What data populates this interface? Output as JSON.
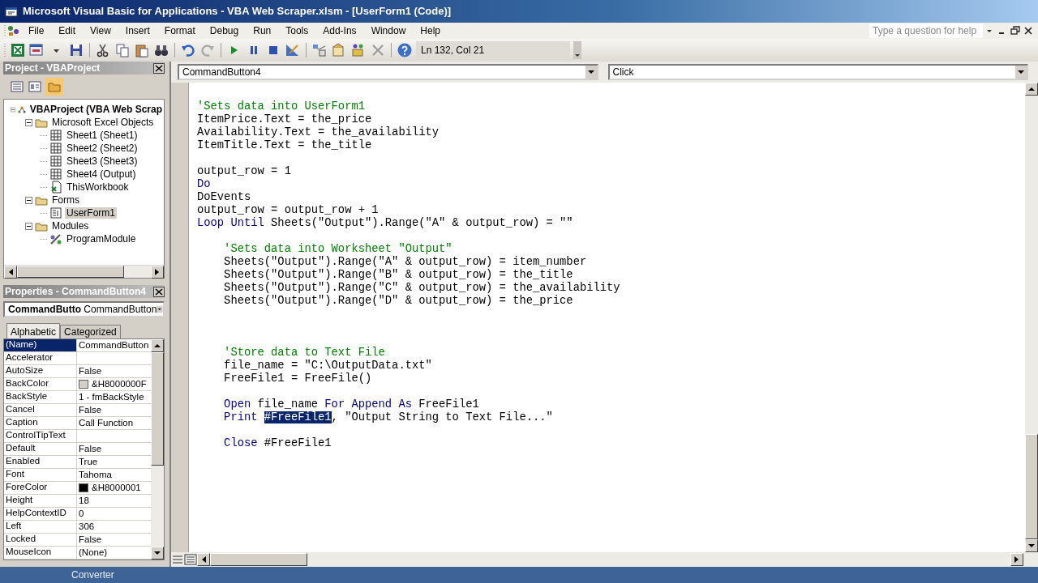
{
  "window": {
    "title": "Microsoft Visual Basic for Applications - VBA Web Scraper.xlsm - [UserForm1 (Code)]"
  },
  "menu": [
    "File",
    "Edit",
    "View",
    "Insert",
    "Format",
    "Debug",
    "Run",
    "Tools",
    "Add-Ins",
    "Window",
    "Help"
  ],
  "help_box": {
    "placeholder": "Type a question for help"
  },
  "toolbar": {
    "position": "Ln 132, Col 21"
  },
  "project": {
    "title": "Project - VBAProject",
    "tree": [
      {
        "label": "VBAProject (VBA Web Scrap",
        "kind": "project",
        "expanded": true,
        "selected": false,
        "children": [
          {
            "label": "Microsoft Excel Objects",
            "kind": "folder",
            "expanded": true,
            "selected": false,
            "children": [
              {
                "label": "Sheet1 (Sheet1)",
                "kind": "sheet",
                "selected": false
              },
              {
                "label": "Sheet2 (Sheet2)",
                "kind": "sheet",
                "selected": false
              },
              {
                "label": "Sheet3 (Sheet3)",
                "kind": "sheet",
                "selected": false
              },
              {
                "label": "Sheet4 (Output)",
                "kind": "sheet",
                "selected": false
              },
              {
                "label": "ThisWorkbook",
                "kind": "workbook",
                "selected": false
              }
            ]
          },
          {
            "label": "Forms",
            "kind": "folder",
            "expanded": true,
            "selected": false,
            "children": [
              {
                "label": "UserForm1",
                "kind": "form",
                "selected": true
              }
            ]
          },
          {
            "label": "Modules",
            "kind": "folder",
            "expanded": true,
            "selected": false,
            "children": [
              {
                "label": "ProgramModule",
                "kind": "module",
                "selected": false
              }
            ]
          }
        ]
      }
    ]
  },
  "properties": {
    "title": "Properties - CommandButton4",
    "object_name": "CommandButto",
    "object_type": "CommandButton",
    "tabs": [
      {
        "label": "Alphabetic",
        "selected": true
      },
      {
        "label": "Categorized",
        "selected": false
      }
    ],
    "rows": [
      {
        "name": "(Name)",
        "value": "CommandButton",
        "selected": true
      },
      {
        "name": "Accelerator",
        "selected": false
      },
      {
        "name": "AutoSize",
        "value": "False",
        "selected": false
      },
      {
        "name": "BackColor",
        "value": "&H8000000F",
        "color": "#d4d0c8",
        "selected": false
      },
      {
        "name": "BackStyle",
        "value": "1 - fmBackStyle",
        "selected": false
      },
      {
        "name": "Cancel",
        "value": "False",
        "selected": false
      },
      {
        "name": "Caption",
        "value": "Call Function",
        "selected": false
      },
      {
        "name": "ControlTipText",
        "selected": false
      },
      {
        "name": "Default",
        "value": "False",
        "selected": false
      },
      {
        "name": "Enabled",
        "value": "True",
        "selected": false
      },
      {
        "name": "Font",
        "value": "Tahoma",
        "selected": false
      },
      {
        "name": "ForeColor",
        "value": "&H8000001",
        "color": "#000000",
        "selected": false
      },
      {
        "name": "Height",
        "value": "18",
        "selected": false
      },
      {
        "name": "HelpContextID",
        "value": "0",
        "selected": false
      },
      {
        "name": "Left",
        "value": "306",
        "selected": false
      },
      {
        "name": "Locked",
        "value": "False",
        "selected": false
      },
      {
        "name": "MouseIcon",
        "value": "(None)",
        "selected": false
      }
    ]
  },
  "code": {
    "object": "CommandButton4",
    "procedure": "Click",
    "lines": [
      {
        "kind": "comment",
        "text": "'Sets data into UserForm1"
      },
      {
        "kind": "code",
        "segments": [
          {
            "kind": "plain",
            "text": "ItemPrice.Text = the_price"
          }
        ]
      },
      {
        "kind": "code",
        "segments": [
          {
            "kind": "plain",
            "text": "Availability.Text = the_availability"
          }
        ]
      },
      {
        "kind": "code",
        "segments": [
          {
            "kind": "plain",
            "text": "ItemTitle.Text = the_title"
          }
        ]
      },
      {
        "kind": "blank"
      },
      {
        "kind": "code",
        "segments": [
          {
            "kind": "plain",
            "text": "output_row = 1"
          }
        ]
      },
      {
        "kind": "code",
        "segments": [
          {
            "kind": "keyword",
            "text": "Do"
          }
        ]
      },
      {
        "kind": "code",
        "segments": [
          {
            "kind": "plain",
            "text": "DoEvents"
          }
        ]
      },
      {
        "kind": "code",
        "segments": [
          {
            "kind": "plain",
            "text": "output_row = output_row + 1"
          }
        ]
      },
      {
        "kind": "code",
        "segments": [
          {
            "kind": "keyword",
            "text": "Loop Until"
          },
          {
            "kind": "plain",
            "text": " Sheets(\"Output\").Range(\"A\" & output_row) = \"\""
          }
        ]
      },
      {
        "kind": "blank"
      },
      {
        "kind": "comment",
        "text": "    'Sets data into Worksheet \"Output\""
      },
      {
        "kind": "code",
        "segments": [
          {
            "kind": "plain",
            "text": "    Sheets(\"Output\").Range(\"A\" & output_row) = item_number"
          }
        ]
      },
      {
        "kind": "code",
        "segments": [
          {
            "kind": "plain",
            "text": "    Sheets(\"Output\").Range(\"B\" & output_row) = the_title"
          }
        ]
      },
      {
        "kind": "code",
        "segments": [
          {
            "kind": "plain",
            "text": "    Sheets(\"Output\").Range(\"C\" & output_row) = the_availability"
          }
        ]
      },
      {
        "kind": "code",
        "segments": [
          {
            "kind": "plain",
            "text": "    Sheets(\"Output\").Range(\"D\" & output_row) = the_price"
          }
        ]
      },
      {
        "kind": "blank"
      },
      {
        "kind": "blank"
      },
      {
        "kind": "blank"
      },
      {
        "kind": "comment",
        "text": "    'Store data to Text File"
      },
      {
        "kind": "code",
        "segments": [
          {
            "kind": "plain",
            "text": "    file_name = \"C:\\OutputData.txt\""
          }
        ]
      },
      {
        "kind": "code",
        "segments": [
          {
            "kind": "plain",
            "text": "    FreeFile1 = FreeFile()"
          }
        ]
      },
      {
        "kind": "blank"
      },
      {
        "kind": "code",
        "segments": [
          {
            "kind": "keyword",
            "text": "    Open"
          },
          {
            "kind": "plain",
            "text": " file_name "
          },
          {
            "kind": "keyword",
            "text": "For Append As"
          },
          {
            "kind": "plain",
            "text": " FreeFile1"
          }
        ]
      },
      {
        "kind": "code",
        "segments": [
          {
            "kind": "keyword",
            "text": "    Print "
          },
          {
            "kind": "selected",
            "text": "#FreeFile1"
          },
          {
            "kind": "plain",
            "text": ", \"Output String to Text File...\""
          }
        ]
      },
      {
        "kind": "blank"
      },
      {
        "kind": "code",
        "segments": [
          {
            "kind": "keyword",
            "text": "    Close"
          },
          {
            "kind": "plain",
            "text": " #FreeFile1"
          }
        ]
      }
    ]
  },
  "taskbar": {
    "items": [
      {
        "label": "Converter"
      }
    ]
  }
}
